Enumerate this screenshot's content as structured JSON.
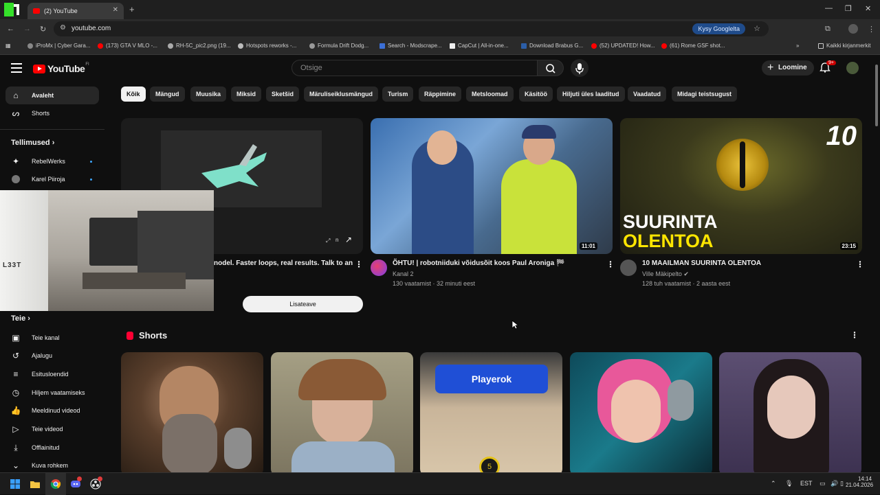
{
  "browser": {
    "tab_title": "(2) YouTube",
    "url": "youtube.com",
    "ask_google": "Kysy Googlelta",
    "bookmarks": [
      "iProMx | Cyber Gara...",
      "(173) GTA V MLO -...",
      "RH-5C_pic2.png (19...",
      "Hotspots reworks -...",
      "Formula Drift Dodg...",
      "Search - Modscrape...",
      "CapCut | All-in-one...",
      "Download Brabus G...",
      "(52) UPDATED! How...",
      "(61) Rome GSF shot..."
    ],
    "all_bookmarks": "Kaikki kirjanmerkit"
  },
  "yt": {
    "logo": "YouTube",
    "country_code": "FI",
    "search_placeholder": "Otsige",
    "create_label": "Loomine",
    "notif_count": "9+"
  },
  "sidebar": {
    "home": "Avaleht",
    "shorts": "Shorts",
    "subs_header": "Tellimused",
    "subs": [
      "RebelWerks",
      "Karel Piiroja"
    ],
    "you_header": "Teie",
    "you_items": [
      "Teie kanal",
      "Ajalugu",
      "Esitusloendid",
      "Hiljem vaatamiseks",
      "Meeldinud videod",
      "Teie videod",
      "Offlainitud",
      "Kuva rohkem"
    ]
  },
  "chips": [
    "Kõik",
    "Mängud",
    "Muusika",
    "Miksid",
    "Sketšid",
    "Märuliseiklusmängud",
    "Turism",
    "Räppimine",
    "Metsloomad",
    "Käsitöö",
    "Hiljuti üles laaditud",
    "Vaadatud",
    "Midagi teistsugust"
  ],
  "ad": {
    "title_fragment": "nodel. Faster loops, real results. Talk to an",
    "more_button": "Lisateave",
    "thumb_label": "n"
  },
  "videos": [
    {
      "title": "ÕHTU! | robotniiduki võidusõit koos Paul Aroniga 🏁",
      "channel": "Kanal 2",
      "meta": "130 vaatamist · 32 minuti eest",
      "duration": "11:01"
    },
    {
      "title": "10 MAAILMAN SUURINTA OLENTOA",
      "channel": "Ville Mäkipelto",
      "meta": "128 tuh vaatamist · 2 aasta eest",
      "duration": "23:15",
      "thumb_text_top": "10",
      "thumb_text_1": "SUURINTA",
      "thumb_text_2": "OLENTOA"
    }
  ],
  "shorts": {
    "header": "Shorts",
    "playerok": "Playerok",
    "number": "5"
  },
  "taskbar": {
    "lang": "EST",
    "time": "14:14",
    "date": "21.04.2026"
  }
}
